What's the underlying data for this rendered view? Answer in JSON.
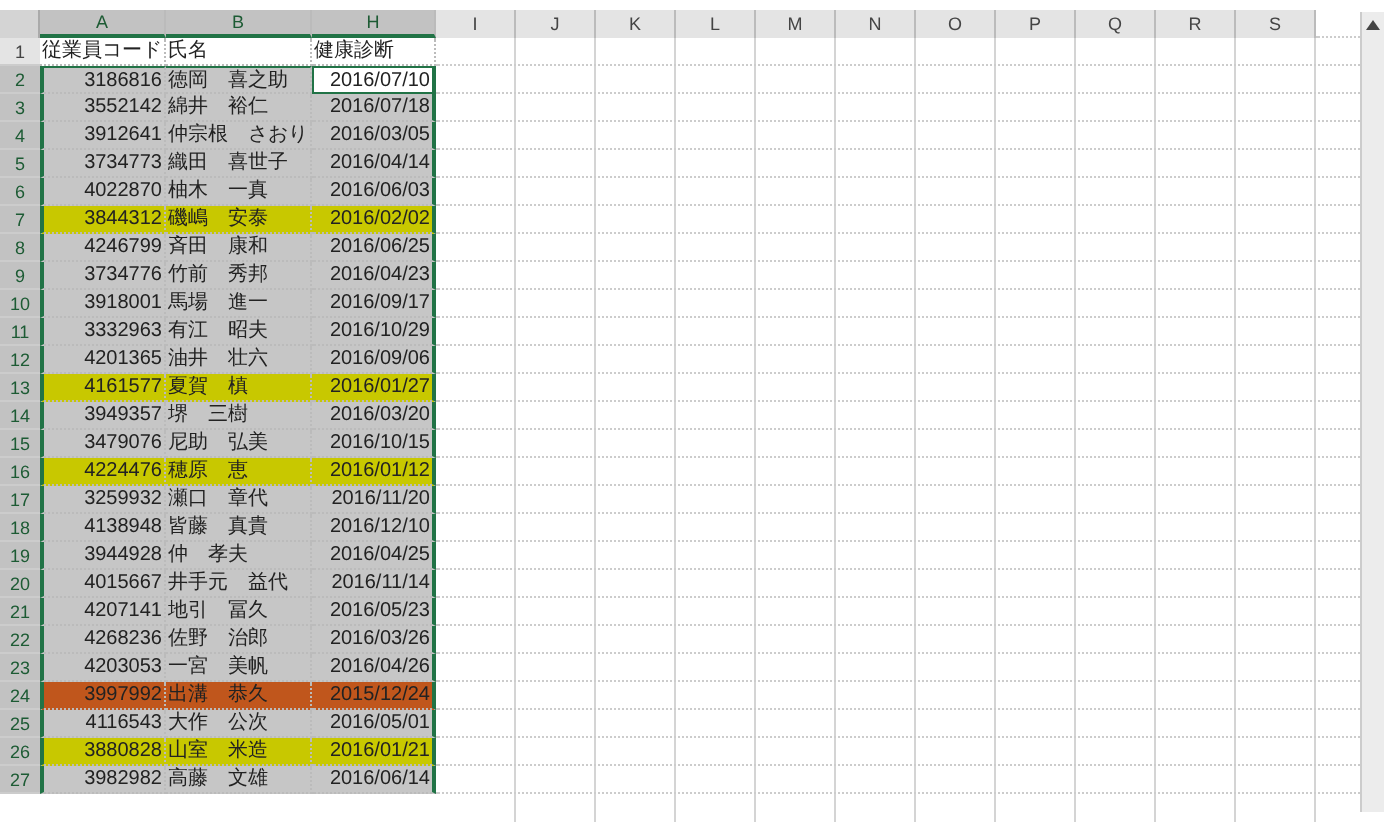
{
  "columns": [
    {
      "label": "A",
      "selected": true
    },
    {
      "label": "B",
      "selected": true
    },
    {
      "label": "H",
      "selected": true
    },
    {
      "label": "I",
      "selected": false
    },
    {
      "label": "J",
      "selected": false
    },
    {
      "label": "K",
      "selected": false
    },
    {
      "label": "L",
      "selected": false
    },
    {
      "label": "M",
      "selected": false
    },
    {
      "label": "N",
      "selected": false
    },
    {
      "label": "O",
      "selected": false
    },
    {
      "label": "P",
      "selected": false
    },
    {
      "label": "Q",
      "selected": false
    },
    {
      "label": "R",
      "selected": false
    },
    {
      "label": "S",
      "selected": false
    }
  ],
  "header_row": {
    "number": "1",
    "cells": [
      "従業員コード",
      "氏名",
      "健康診断"
    ]
  },
  "rows": [
    {
      "number": "2",
      "code": "3186816",
      "name": "徳岡　喜之助",
      "date": "2016/07/10",
      "selected": true,
      "active": true
    },
    {
      "number": "3",
      "code": "3552142",
      "name": "綿井　裕仁",
      "date": "2016/07/18",
      "selected": true,
      "active": false
    },
    {
      "number": "4",
      "code": "3912641",
      "name": "仲宗根　さおり",
      "date": "2016/03/05",
      "selected": true,
      "active": false
    },
    {
      "number": "5",
      "code": "3734773",
      "name": "織田　喜世子",
      "date": "2016/04/14",
      "selected": true,
      "active": false
    },
    {
      "number": "6",
      "code": "4022870",
      "name": "柚木　一真",
      "date": "2016/06/03",
      "selected": true,
      "active": false
    },
    {
      "number": "7",
      "code": "3844312",
      "name": "磯嶋　安泰",
      "date": "2016/02/02",
      "selected": true,
      "active": false,
      "color": "#c8c800"
    },
    {
      "number": "8",
      "code": "4246799",
      "name": "斉田　康和",
      "date": "2016/06/25",
      "selected": true,
      "active": false
    },
    {
      "number": "9",
      "code": "3734776",
      "name": "竹前　秀邦",
      "date": "2016/04/23",
      "selected": true,
      "active": false
    },
    {
      "number": "10",
      "code": "3918001",
      "name": "馬場　進一",
      "date": "2016/09/17",
      "selected": true,
      "active": false
    },
    {
      "number": "11",
      "code": "3332963",
      "name": "有江　昭夫",
      "date": "2016/10/29",
      "selected": true,
      "active": false
    },
    {
      "number": "12",
      "code": "4201365",
      "name": "油井　壮六",
      "date": "2016/09/06",
      "selected": true,
      "active": false
    },
    {
      "number": "13",
      "code": "4161577",
      "name": "夏賀　槙",
      "date": "2016/01/27",
      "selected": true,
      "active": false,
      "color": "#c8c800"
    },
    {
      "number": "14",
      "code": "3949357",
      "name": "堺　三樹",
      "date": "2016/03/20",
      "selected": true,
      "active": false
    },
    {
      "number": "15",
      "code": "3479076",
      "name": "尼助　弘美",
      "date": "2016/10/15",
      "selected": true,
      "active": false
    },
    {
      "number": "16",
      "code": "4224476",
      "name": "穂原　恵",
      "date": "2016/01/12",
      "selected": true,
      "active": false,
      "color": "#c8c800"
    },
    {
      "number": "17",
      "code": "3259932",
      "name": "瀬口　章代",
      "date": "2016/11/20",
      "selected": true,
      "active": false
    },
    {
      "number": "18",
      "code": "4138948",
      "name": "皆藤　真貴",
      "date": "2016/12/10",
      "selected": true,
      "active": false
    },
    {
      "number": "19",
      "code": "3944928",
      "name": "仲　孝夫",
      "date": "2016/04/25",
      "selected": true,
      "active": false
    },
    {
      "number": "20",
      "code": "4015667",
      "name": "井手元　益代",
      "date": "2016/11/14",
      "selected": true,
      "active": false
    },
    {
      "number": "21",
      "code": "4207141",
      "name": "地引　冨久",
      "date": "2016/05/23",
      "selected": true,
      "active": false
    },
    {
      "number": "22",
      "code": "4268236",
      "name": "佐野　治郎",
      "date": "2016/03/26",
      "selected": true,
      "active": false
    },
    {
      "number": "23",
      "code": "4203053",
      "name": "一宮　美帆",
      "date": "2016/04/26",
      "selected": true,
      "active": false
    },
    {
      "number": "24",
      "code": "3997992",
      "name": "出溝　恭久",
      "date": "2015/12/24",
      "selected": true,
      "active": false,
      "color": "#c0561c"
    },
    {
      "number": "25",
      "code": "4116543",
      "name": "大作　公次",
      "date": "2016/05/01",
      "selected": true,
      "active": false
    },
    {
      "number": "26",
      "code": "3880828",
      "name": "山室　米造",
      "date": "2016/01/21",
      "selected": true,
      "active": false,
      "color": "#c8c800"
    },
    {
      "number": "27",
      "code": "3982982",
      "name": "高藤　文雄",
      "date": "2016/06/14",
      "selected": true,
      "active": false
    }
  ]
}
